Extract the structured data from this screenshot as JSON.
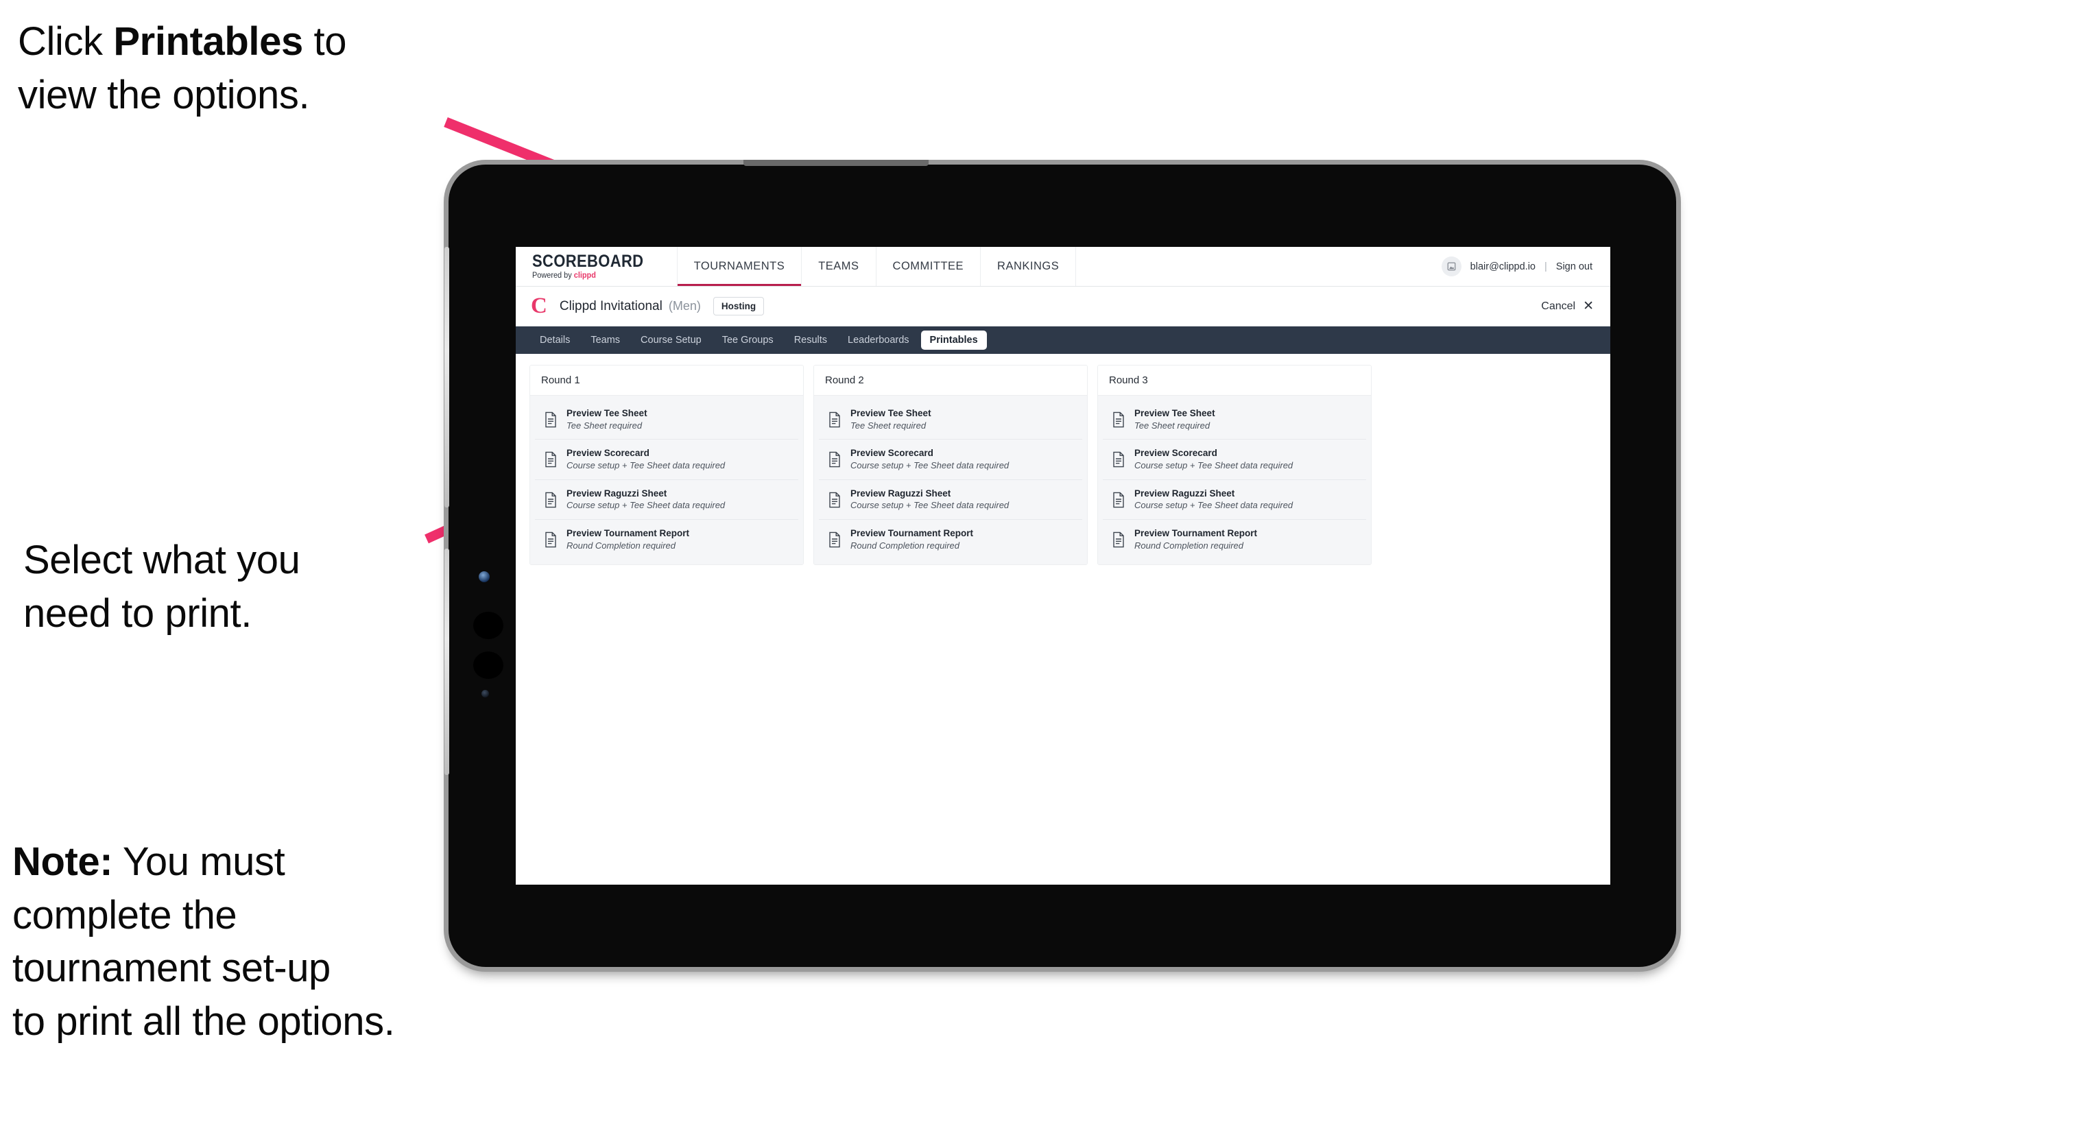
{
  "annotations": {
    "top": {
      "prefix": "Click ",
      "bold": "Printables",
      "suffix": " to\nview the options."
    },
    "middle": {
      "text": "Select what you\n need to print."
    },
    "bottom": {
      "bold": "Note:",
      "text": " You must\ncomplete the\ntournament set-up\nto print all the options."
    }
  },
  "colors": {
    "arrow_pink": "#ef2f6b",
    "brand_pink": "#e8386a",
    "tabbar_navy": "#2e3949",
    "active_underline": "#b81e4d"
  },
  "app": {
    "brand": {
      "title": "SCOREBOARD",
      "powered_prefix": "Powered by ",
      "powered_brand": "clippd"
    },
    "top_nav": [
      {
        "label": "TOURNAMENTS",
        "active": true
      },
      {
        "label": "TEAMS",
        "active": false
      },
      {
        "label": "COMMITTEE",
        "active": false
      },
      {
        "label": "RANKINGS",
        "active": false
      }
    ],
    "account": {
      "avatar_icon": "user-avatar-icon",
      "email": "blair@clippd.io",
      "separator": "|",
      "sign_out": "Sign out"
    },
    "tournament_bar": {
      "logo_letter": "C",
      "name": "Clippd Invitational",
      "gender": "(Men)",
      "badge": "Hosting",
      "cancel_label": "Cancel",
      "cancel_icon": "✕"
    },
    "tabs": [
      {
        "label": "Details",
        "active": false
      },
      {
        "label": "Teams",
        "active": false
      },
      {
        "label": "Course Setup",
        "active": false
      },
      {
        "label": "Tee Groups",
        "active": false
      },
      {
        "label": "Results",
        "active": false
      },
      {
        "label": "Leaderboards",
        "active": false
      },
      {
        "label": "Printables",
        "active": true
      }
    ],
    "rounds": [
      {
        "title": "Round 1",
        "items": [
          {
            "title": "Preview Tee Sheet",
            "subtitle": "Tee Sheet required"
          },
          {
            "title": "Preview Scorecard",
            "subtitle": "Course setup + Tee Sheet data required"
          },
          {
            "title": "Preview Raguzzi Sheet",
            "subtitle": "Course setup + Tee Sheet data required"
          },
          {
            "title": "Preview Tournament Report",
            "subtitle": "Round Completion required"
          }
        ]
      },
      {
        "title": "Round 2",
        "items": [
          {
            "title": "Preview Tee Sheet",
            "subtitle": "Tee Sheet required"
          },
          {
            "title": "Preview Scorecard",
            "subtitle": "Course setup + Tee Sheet data required"
          },
          {
            "title": "Preview Raguzzi Sheet",
            "subtitle": "Course setup + Tee Sheet data required"
          },
          {
            "title": "Preview Tournament Report",
            "subtitle": "Round Completion required"
          }
        ]
      },
      {
        "title": "Round 3",
        "items": [
          {
            "title": "Preview Tee Sheet",
            "subtitle": "Tee Sheet required"
          },
          {
            "title": "Preview Scorecard",
            "subtitle": "Course setup + Tee Sheet data required"
          },
          {
            "title": "Preview Raguzzi Sheet",
            "subtitle": "Course setup + Tee Sheet data required"
          },
          {
            "title": "Preview Tournament Report",
            "subtitle": "Round Completion required"
          }
        ]
      }
    ]
  }
}
